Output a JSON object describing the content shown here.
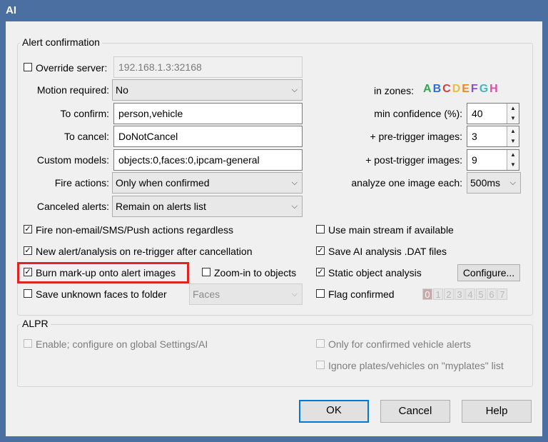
{
  "window": {
    "title": "AI"
  },
  "alert_confirmation": {
    "title": "Alert confirmation",
    "override_server": {
      "label": "Override server:",
      "checked": false,
      "value": "192.168.1.3:32168"
    },
    "motion_required": {
      "label": "Motion required:",
      "value": "No"
    },
    "to_confirm": {
      "label": "To confirm:",
      "value": "person,vehicle"
    },
    "to_cancel": {
      "label": "To cancel:",
      "value": "DoNotCancel"
    },
    "custom_models": {
      "label": "Custom models:",
      "value": "objects:0,faces:0,ipcam-general"
    },
    "fire_actions": {
      "label": "Fire actions:",
      "value": "Only when confirmed"
    },
    "canceled_alerts": {
      "label": "Canceled alerts:",
      "value": "Remain on alerts list"
    },
    "in_zones": {
      "label": "in zones:",
      "zones": [
        {
          "letter": "A",
          "color": "#2fa84f"
        },
        {
          "letter": "B",
          "color": "#2b6fd6"
        },
        {
          "letter": "C",
          "color": "#d63a3a"
        },
        {
          "letter": "D",
          "color": "#e8c040"
        },
        {
          "letter": "E",
          "color": "#e58a2c"
        },
        {
          "letter": "F",
          "color": "#8a4fc9"
        },
        {
          "letter": "G",
          "color": "#3fb7c9"
        },
        {
          "letter": "H",
          "color": "#d94fa3"
        }
      ]
    },
    "min_confidence": {
      "label": "min confidence (%):",
      "value": "40"
    },
    "pre_trigger": {
      "label": "+ pre-trigger images:",
      "value": "3"
    },
    "post_trigger": {
      "label": "+ post-trigger images:",
      "value": "9"
    },
    "analyze_each": {
      "label": "analyze one image each:",
      "value": "500ms"
    },
    "checks": {
      "fire_non_email": {
        "label": "Fire non-email/SMS/Push actions regardless",
        "checked": true
      },
      "new_alert": {
        "label": "New alert/analysis on re-trigger after cancellation",
        "checked": true
      },
      "burn_markup": {
        "label": "Burn mark-up onto alert images",
        "checked": true
      },
      "zoom_in": {
        "label": "Zoom-in to objects",
        "checked": false
      },
      "save_unknown": {
        "label": "Save unknown faces to folder",
        "checked": false
      },
      "main_stream": {
        "label": "Use main stream if available",
        "checked": false
      },
      "save_dat": {
        "label": "Save AI analysis .DAT files",
        "checked": true
      },
      "static_object": {
        "label": "Static object analysis",
        "checked": true
      },
      "flag_confirmed": {
        "label": "Flag confirmed",
        "checked": false
      }
    },
    "faces_folder": "Faces",
    "configure_label": "Configure...",
    "flag_digits": [
      "0",
      "1",
      "2",
      "3",
      "4",
      "5",
      "6",
      "7"
    ]
  },
  "alpr": {
    "title": "ALPR",
    "enable": {
      "label": "Enable; configure on global Settings/AI",
      "checked": false
    },
    "only_confirmed": {
      "label": "Only for confirmed vehicle alerts",
      "checked": false
    },
    "ignore_plates": {
      "label": "Ignore plates/vehicles on \"myplates\" list",
      "checked": false
    }
  },
  "buttons": {
    "ok": "OK",
    "cancel": "Cancel",
    "help": "Help"
  },
  "check_glyph": "✓",
  "chevron_glyph": "⌵",
  "spin_up_glyph": "▲",
  "spin_down_glyph": "▼"
}
